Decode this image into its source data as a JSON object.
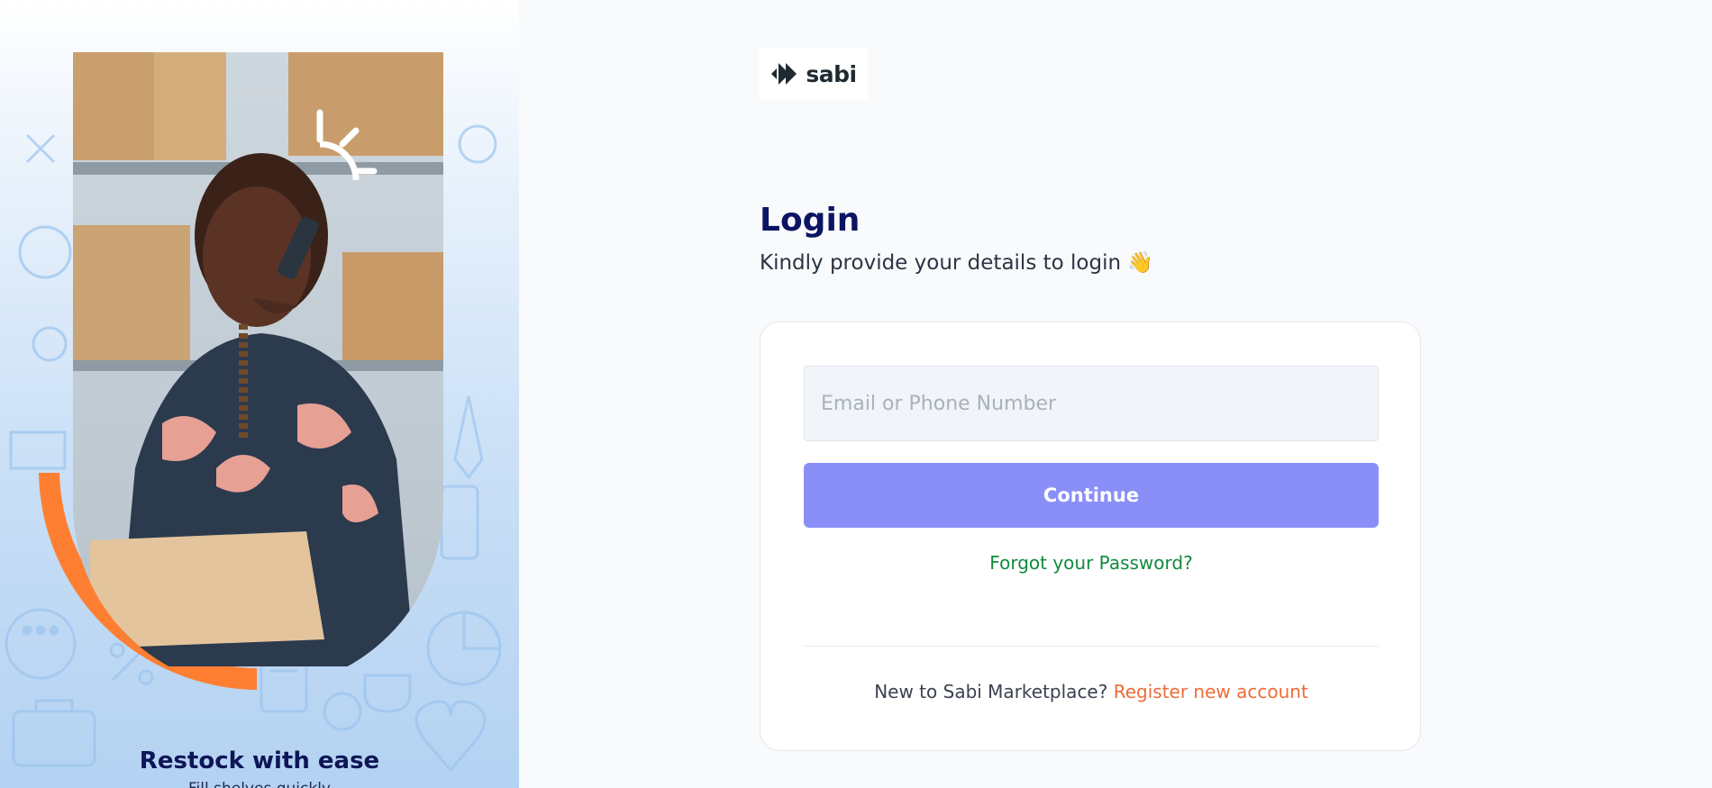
{
  "brand": {
    "logo_text": "sabi"
  },
  "hero": {
    "tagline": "Restock with ease",
    "tagline_sub": "Fill shelves quickly"
  },
  "login": {
    "title": "Login",
    "subtitle": "Kindly provide your details to login 👋",
    "email_placeholder": "Email or Phone Number",
    "continue_label": "Continue",
    "forgot_label": "Forgot your Password?",
    "new_user_text": "New to Sabi Marketplace? ",
    "register_label": "Register new account"
  },
  "colors": {
    "primary_button": "#8a8ff8",
    "title": "#0d1463",
    "forgot_link": "#108a3e",
    "register_link": "#ef6c38",
    "accent_arc": "#ff7f32"
  }
}
